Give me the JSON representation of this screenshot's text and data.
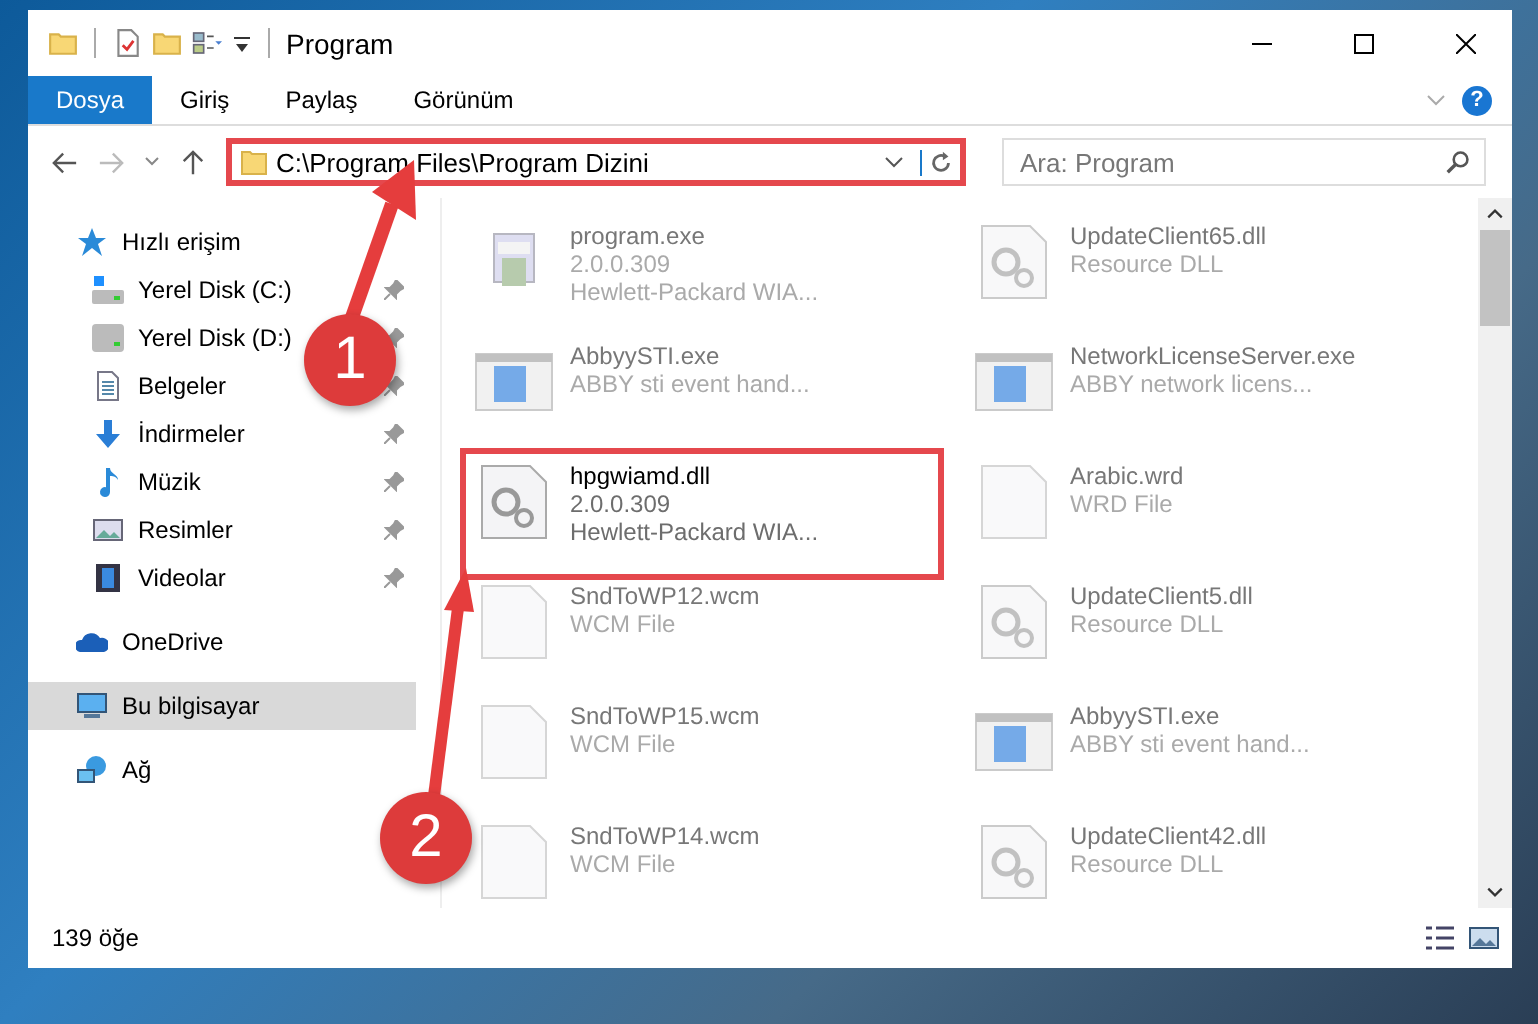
{
  "window": {
    "title": "Program"
  },
  "ribbon": {
    "tabs": [
      {
        "label": "Dosya",
        "selected": true
      },
      {
        "label": "Giriş",
        "selected": false
      },
      {
        "label": "Paylaş",
        "selected": false
      },
      {
        "label": "Görünüm",
        "selected": false
      }
    ],
    "help_label": "?"
  },
  "address_bar": {
    "path": "C:\\Program Files\\Program Dizini",
    "highlighted": true
  },
  "search": {
    "placeholder": "Ara: Program"
  },
  "sidebar": {
    "items": [
      {
        "label": "Hızlı erişim",
        "selected": false,
        "children": [
          {
            "label": "Yerel Disk (C:)",
            "pinned": true,
            "selected": false
          },
          {
            "label": "Yerel Disk (D:)",
            "pinned": true,
            "selected": false
          },
          {
            "label": "Belgeler",
            "pinned": true,
            "selected": false
          },
          {
            "label": "İndirmeler",
            "pinned": true,
            "selected": false
          },
          {
            "label": "Müzik",
            "pinned": true,
            "selected": false
          },
          {
            "label": "Resimler",
            "pinned": true,
            "selected": false
          },
          {
            "label": "Videolar",
            "pinned": true,
            "selected": false
          }
        ]
      },
      {
        "label": "OneDrive",
        "selected": false
      },
      {
        "label": "Bu bilgisayar",
        "selected": true
      },
      {
        "label": "Ağ",
        "selected": false
      }
    ]
  },
  "files": [
    {
      "name": "program.exe",
      "details": [
        "2.0.0.309",
        "Hewlett-Packard WIA..."
      ],
      "kind": "program",
      "highlighted": false
    },
    {
      "name": "UpdateClient65.dll",
      "details": [
        "Resource DLL"
      ],
      "kind": "dll",
      "highlighted": false
    },
    {
      "name": "AbbyySTI.exe",
      "details": [
        "ABBY sti event hand..."
      ],
      "kind": "app",
      "highlighted": false
    },
    {
      "name": "NetworkLicenseServer.exe",
      "details": [
        "ABBY network licens..."
      ],
      "kind": "app",
      "highlighted": false
    },
    {
      "name": "hpgwiamd.dll",
      "details": [
        "2.0.0.309",
        "Hewlett-Packard WIA..."
      ],
      "kind": "dll",
      "highlighted": true
    },
    {
      "name": "Arabic.wrd",
      "details": [
        "WRD File"
      ],
      "kind": "blank",
      "highlighted": false
    },
    {
      "name": "SndToWP12.wcm",
      "details": [
        "WCM File"
      ],
      "kind": "blank",
      "highlighted": false
    },
    {
      "name": "UpdateClient5.dll",
      "details": [
        "Resource DLL"
      ],
      "kind": "dll",
      "highlighted": false
    },
    {
      "name": "SndToWP15.wcm",
      "details": [
        "WCM File"
      ],
      "kind": "blank",
      "highlighted": false
    },
    {
      "name": "AbbyySTI.exe",
      "details": [
        "ABBY sti event hand..."
      ],
      "kind": "app",
      "highlighted": false
    },
    {
      "name": "SndToWP14.wcm",
      "details": [
        "WCM File"
      ],
      "kind": "blank",
      "highlighted": false
    },
    {
      "name": "UpdateClient42.dll",
      "details": [
        "Resource DLL"
      ],
      "kind": "dll",
      "highlighted": false
    }
  ],
  "status_bar": {
    "count": "139 öğe"
  },
  "callouts": [
    {
      "number": "1"
    },
    {
      "number": "2"
    }
  ]
}
